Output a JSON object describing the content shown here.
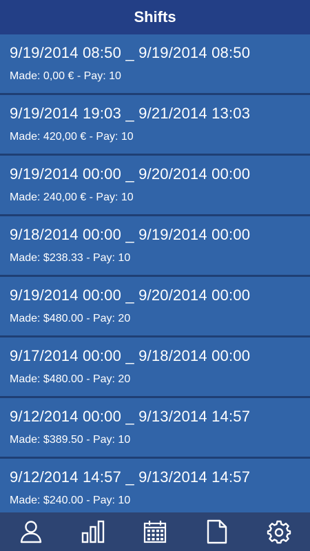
{
  "header": {
    "title": "Shifts"
  },
  "shifts": [
    {
      "range": "9/19/2014 08:50 _ 9/19/2014 08:50",
      "summary": "Made: 0,00 € - Pay: 10"
    },
    {
      "range": "9/19/2014 19:03 _ 9/21/2014 13:03",
      "summary": "Made: 420,00 € - Pay: 10"
    },
    {
      "range": "9/19/2014 00:00 _ 9/20/2014 00:00",
      "summary": "Made: 240,00 € - Pay: 10"
    },
    {
      "range": "9/18/2014 00:00 _ 9/19/2014 00:00",
      "summary": "Made: $238.33 - Pay: 10"
    },
    {
      "range": "9/19/2014 00:00 _ 9/20/2014 00:00",
      "summary": "Made: $480.00 - Pay: 20"
    },
    {
      "range": "9/17/2014 00:00 _ 9/18/2014 00:00",
      "summary": "Made: $480.00 - Pay: 20"
    },
    {
      "range": "9/12/2014 00:00 _ 9/13/2014 14:57",
      "summary": "Made: $389.50 - Pay: 10"
    },
    {
      "range": "9/12/2014 14:57 _ 9/13/2014 14:57",
      "summary": "Made: $240.00 - Pay: 10"
    }
  ],
  "tabs": [
    {
      "icon": "user-icon"
    },
    {
      "icon": "bar-chart-icon"
    },
    {
      "icon": "calendar-icon"
    },
    {
      "icon": "document-icon"
    },
    {
      "icon": "gear-icon"
    }
  ],
  "colors": {
    "header": "#233f86",
    "item": "#3164a8",
    "separator": "#1f3f74",
    "tabbar": "#2d4472",
    "icon": "#ffffff"
  }
}
